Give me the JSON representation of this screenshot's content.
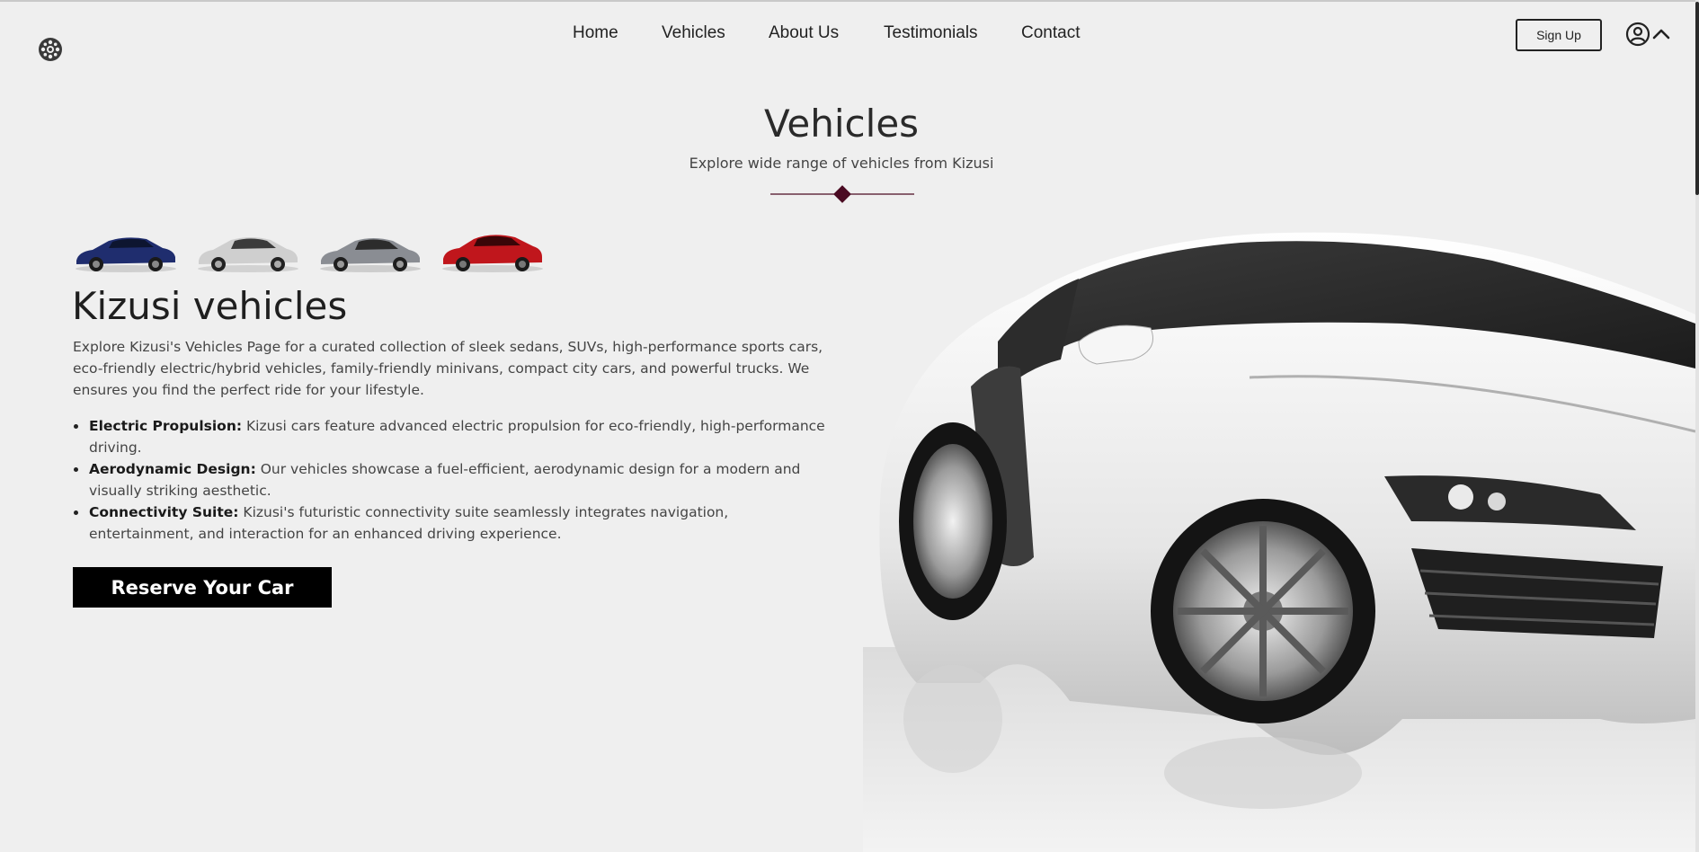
{
  "header": {
    "logo_icon": "wheel-icon",
    "nav": [
      {
        "label": "Home"
      },
      {
        "label": "Vehicles"
      },
      {
        "label": "About Us"
      },
      {
        "label": "Testimonials"
      },
      {
        "label": "Contact"
      }
    ],
    "signup_label": "Sign Up",
    "user_icon": "user-circle-icon",
    "toggle_icon": "chevron-up-icon"
  },
  "hero": {
    "title": "Vehicles",
    "subtitle": "Explore wide range of vehicles from Kizusi",
    "accent_color": "#4a0a22"
  },
  "thumbnails": [
    {
      "name": "blue-coupe",
      "color": "#1f2d6e"
    },
    {
      "name": "silver-sedan",
      "color": "#c9c9c9"
    },
    {
      "name": "grey-sports-car",
      "color": "#8a8d93"
    },
    {
      "name": "red-roadster",
      "color": "#c0161c"
    }
  ],
  "content": {
    "title": "Kizusi vehicles",
    "intro": "Explore Kizusi's Vehicles Page for a curated collection of sleek sedans, SUVs, high-performance sports cars, eco-friendly electric/hybrid vehicles, family-friendly minivans, compact city cars, and powerful trucks. We ensures you find the perfect ride for your lifestyle.",
    "features": [
      {
        "title": "Electric Propulsion:",
        "text": " Kizusi cars feature advanced electric propulsion for eco-friendly, high-performance driving."
      },
      {
        "title": "Aerodynamic Design:",
        "text": " Our vehicles showcase a fuel-efficient, aerodynamic design for a modern and visually striking aesthetic."
      },
      {
        "title": "Connectivity Suite:",
        "text": " Kizusi's futuristic connectivity suite seamlessly integrates navigation, entertainment, and interaction for an enhanced driving experience."
      }
    ],
    "cta_label": "Reserve Your Car"
  },
  "featured_car": {
    "name": "white-sports-car"
  }
}
